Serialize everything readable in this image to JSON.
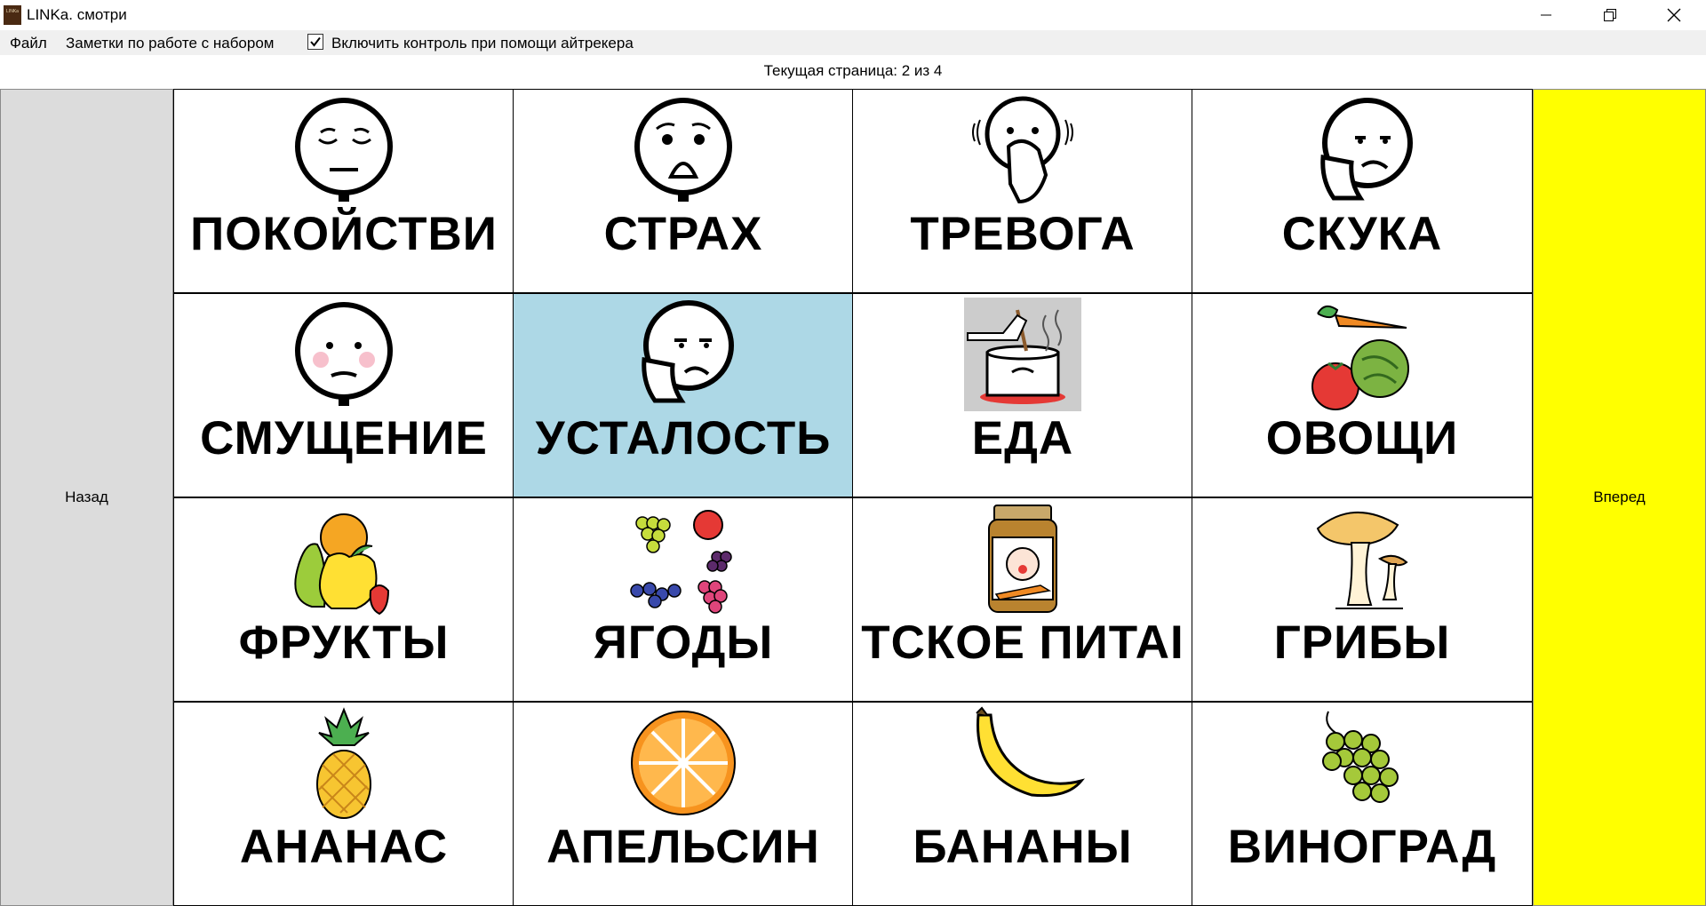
{
  "window": {
    "title": "LINKa. смотри",
    "icon_text": "LINKa",
    "controls": [
      "minimize-icon",
      "restore-icon",
      "close-icon"
    ]
  },
  "menu": {
    "file": "Файл",
    "notes": "Заметки по работе с набором",
    "eyetracker_label": "Включить контроль при помощи айтрекера",
    "eyetracker_checked": true
  },
  "page_indicator": "Текущая страница: 2 из 4",
  "nav": {
    "back": "Назад",
    "forward": "Вперед"
  },
  "colors": {
    "forward_bg": "#ffff00",
    "back_bg": "#dcdcdc",
    "selected_bg": "#add8e6"
  },
  "cards": [
    {
      "label": "ПОКОЙСТВИ",
      "icon": "calm-face-icon",
      "selected": false
    },
    {
      "label": "СТРАХ",
      "icon": "fear-face-icon",
      "selected": false
    },
    {
      "label": "ТРЕВОГА",
      "icon": "anxiety-face-icon",
      "selected": false
    },
    {
      "label": "СКУКА",
      "icon": "boredom-face-icon",
      "selected": false
    },
    {
      "label": "СМУЩЕНИЕ",
      "icon": "embarrassed-face-icon",
      "selected": false
    },
    {
      "label": "УСТАЛОСТЬ",
      "icon": "tired-face-icon",
      "selected": true
    },
    {
      "label": "ЕДА",
      "icon": "cooking-pot-icon",
      "selected": false
    },
    {
      "label": "ОВОЩИ",
      "icon": "vegetables-icon",
      "selected": false
    },
    {
      "label": "ФРУКТЫ",
      "icon": "fruits-icon",
      "selected": false
    },
    {
      "label": "ЯГОДЫ",
      "icon": "berries-icon",
      "selected": false
    },
    {
      "label": "ТСКОЕ ПИТАІ",
      "icon": "baby-food-jar-icon",
      "selected": false
    },
    {
      "label": "ГРИБЫ",
      "icon": "mushrooms-icon",
      "selected": false
    },
    {
      "label": "АНАНАС",
      "icon": "pineapple-icon",
      "selected": false
    },
    {
      "label": "АПЕЛЬСИН",
      "icon": "orange-icon",
      "selected": false
    },
    {
      "label": "БАНАНЫ",
      "icon": "banana-icon",
      "selected": false
    },
    {
      "label": "ВИНОГРАД",
      "icon": "grapes-icon",
      "selected": false
    }
  ]
}
